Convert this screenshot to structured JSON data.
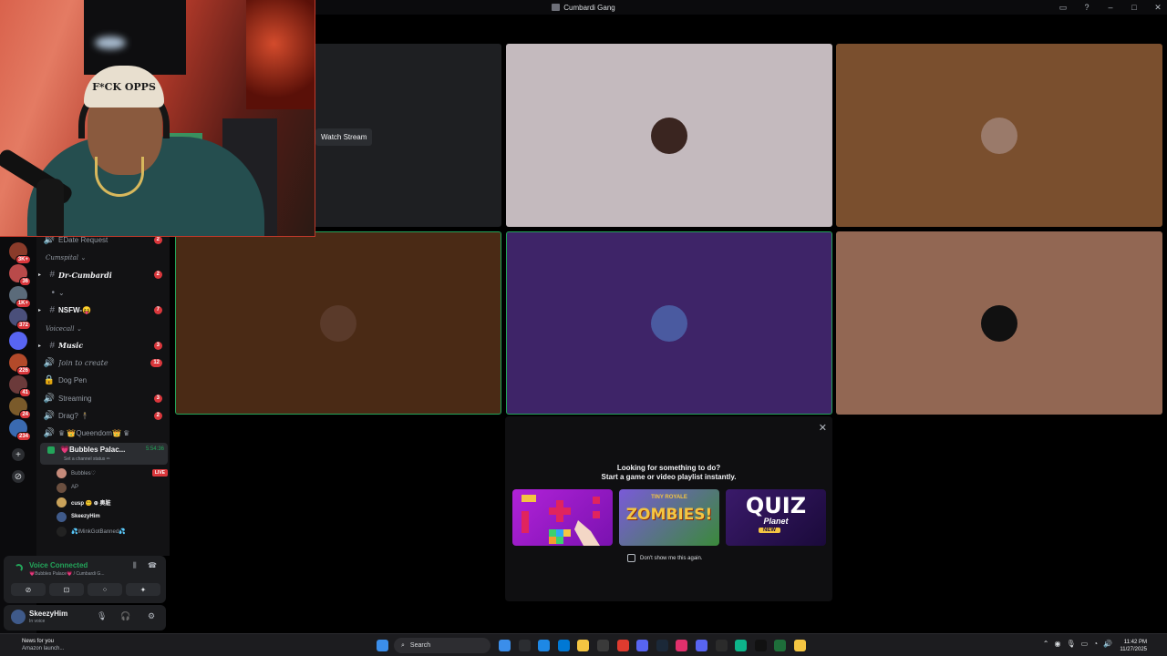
{
  "window": {
    "title": "Cumbardi Gang",
    "controls": [
      "▭",
      "?",
      "–",
      "□",
      "✕"
    ]
  },
  "webcam": {
    "hat_text": "F*CK OPPS"
  },
  "servers": [
    {
      "badge": "3K+",
      "color": "#8a3b2a"
    },
    {
      "badge": "36",
      "color": "#b94a4a"
    },
    {
      "badge": "1K+",
      "color": "#5b6b7a"
    },
    {
      "badge": "372",
      "color": "#4a4f7a"
    },
    {
      "badge": "",
      "color": "#5865f2"
    },
    {
      "badge": "226",
      "color": "#b34a2a"
    },
    {
      "badge": "41",
      "color": "#6b3a3a"
    },
    {
      "badge": "24",
      "color": "#7a5a2a"
    },
    {
      "badge": "234",
      "color": "#3a6ab0"
    }
  ],
  "rail_buttons": [
    "+",
    "⊘"
  ],
  "channels": [
    {
      "name": "EDate Request",
      "badge": "2",
      "icon": "speaker",
      "bright": false,
      "italic": false
    },
    {
      "category": "Cumspital ⌄"
    },
    {
      "name": "Dr-Cumbardi",
      "badge": "2",
      "icon": "#",
      "bright": true,
      "italic": true
    },
    {
      "name": "⌄",
      "badge": "",
      "icon": "•",
      "bright": false,
      "italic": false
    },
    {
      "name": "NSFW-😝",
      "badge": "7",
      "icon": "#",
      "bright": true,
      "italic": false
    },
    {
      "category": "Voicecall ⌄"
    },
    {
      "name": "Music",
      "badge": "3",
      "icon": "#",
      "bright": true,
      "italic": true
    },
    {
      "name": "Join to create",
      "badge": "12",
      "icon": "speaker",
      "bright": false,
      "italic": true
    },
    {
      "name": "Dog Pen",
      "badge": "",
      "icon": "lock",
      "bright": false,
      "italic": false
    },
    {
      "name": "Streaming",
      "badge": "3",
      "icon": "speaker",
      "bright": false,
      "italic": false
    },
    {
      "name": "Drag? 🕴",
      "badge": "2",
      "icon": "speaker",
      "bright": false,
      "italic": false
    },
    {
      "name": "♛ 👑Queendom👑 ♛",
      "badge": "",
      "icon": "speaker",
      "bright": false,
      "italic": false
    }
  ],
  "active_voice": {
    "name": "💗Bubbles Palac...",
    "timer": "5:54:36",
    "status": "Set a channel status ✏"
  },
  "voice_users": [
    {
      "name": "Bubbles♡",
      "live": "LIVE",
      "bright": false
    },
    {
      "name": "AP",
      "live": "",
      "bright": false
    },
    {
      "name": "cusp 😵‍💫 ⊕ 奥脏",
      "live": "",
      "bright": true
    },
    {
      "name": "SkeezyHim",
      "live": "",
      "bright": true
    },
    {
      "name": "💦IMinkGotBanned💦",
      "live": "",
      "bright": false
    }
  ],
  "voice_panel": {
    "label": "Voice Connected",
    "sub": "💗Bubbles Palace💗 / Cumbardi G...",
    "buttons": [
      "⊘",
      "⊡",
      "⁘",
      "✦"
    ]
  },
  "user": {
    "name": "SkeezyHim",
    "status": "In voice"
  },
  "tiles": [
    {
      "bg": "#1e1f22",
      "avatar": "",
      "speaking": false,
      "watch": "Watch Stream"
    },
    {
      "bg": "#c4babe",
      "avatar": "#3a2520",
      "speaking": false,
      "watch": ""
    },
    {
      "bg": "#7a4f2e",
      "avatar": "#9a7a6a",
      "speaking": false,
      "watch": ""
    },
    {
      "bg": "#4a2a15",
      "avatar": "#5a3a2a",
      "speaking": true,
      "watch": ""
    },
    {
      "bg": "#3e2468",
      "avatar": "#4a5aa0",
      "speaking": true,
      "watch": ""
    },
    {
      "bg": "#926753",
      "avatar": "#111111",
      "speaking": false,
      "watch": ""
    }
  ],
  "popup": {
    "line1": "Looking for something to do?",
    "line2": "Start a game or video playlist instantly.",
    "checkbox": "Don't show me this again.",
    "cards": [
      {
        "title": "",
        "color1": "#b122d8",
        "color2": "#7a12b0"
      },
      {
        "title": "ZOMBIES!",
        "color1": "#7a5ad8",
        "color2": "#3a8a3a"
      },
      {
        "title": "QUIZ",
        "color1": "#3a1a6a",
        "color2": "#1a0a3a"
      }
    ],
    "quiz_sub": "Planet",
    "quiz_new": "NEW",
    "zombies_sub": "TINY ROYALE"
  },
  "taskbar": {
    "news_title": "News for you",
    "news_sub": "Amazon launch...",
    "search": "Search",
    "time": "11:42 PM",
    "date": "11/27/2025",
    "apps": [
      "#3b8eea",
      "#2b2d31",
      "#1e88e5",
      "#0078d4",
      "#f4c542",
      "#3a3a3a",
      "#de3b2f",
      "#5865f2",
      "#1b2838",
      "#e1306c",
      "#5865f2",
      "#2b2b2b",
      "#0db48a",
      "#111111",
      "#1e6e3a",
      "#f4c542"
    ]
  }
}
